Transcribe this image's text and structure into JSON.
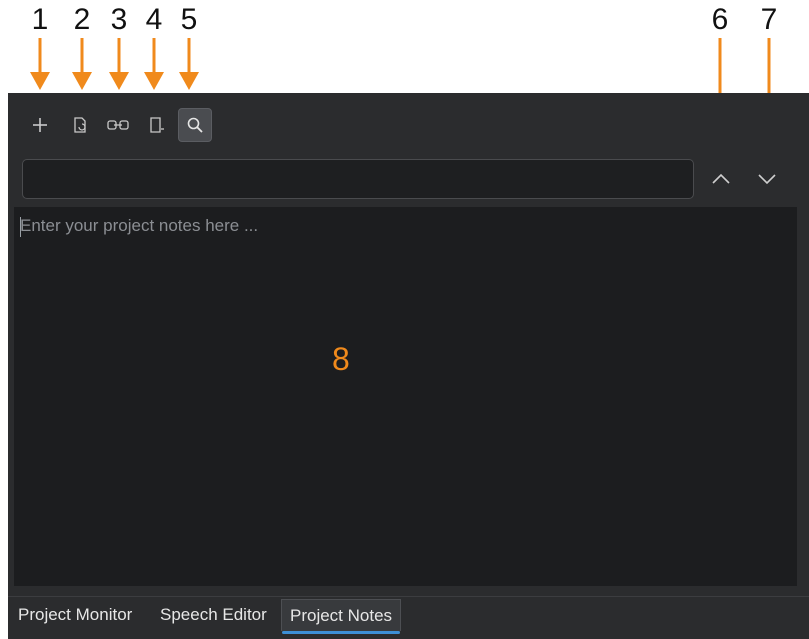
{
  "callouts": [
    "1",
    "2",
    "3",
    "4",
    "5",
    "6",
    "7",
    "8"
  ],
  "toolbar": {
    "icons": [
      "plus-icon",
      "document-refresh-icon",
      "link-icon",
      "bookmark-add-icon",
      "search-icon"
    ],
    "active_tool": "search-icon"
  },
  "search": {
    "value": "",
    "placeholder": "",
    "up_icon": "chevron-up-icon",
    "down_icon": "chevron-down-icon"
  },
  "notes": {
    "placeholder": "Enter your project notes here ..."
  },
  "tabs": [
    {
      "label": "Project Monitor"
    },
    {
      "label": "Speech Editor"
    },
    {
      "label": "Project Notes"
    }
  ],
  "active_tab": "Project Notes",
  "colors": {
    "panel": "#2b2c2e",
    "editor": "#1c1d1f",
    "callout_arrow": "#f08a1c",
    "tab_accent": "#3d8fd6"
  }
}
